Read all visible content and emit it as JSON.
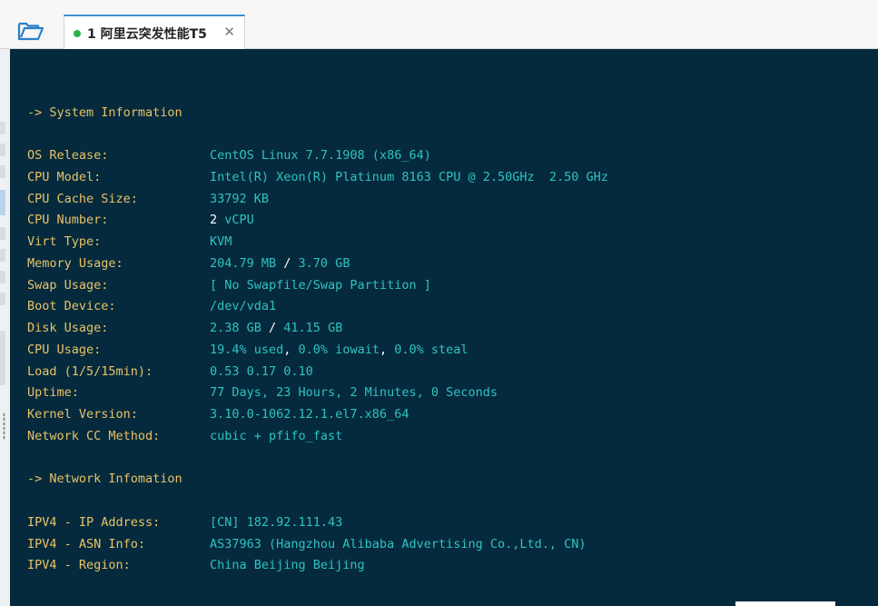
{
  "tab": {
    "label": "1 阿里云突发性能T5",
    "status_color": "#2bb24c",
    "close_icon": "close-icon"
  },
  "terminal": {
    "system_header": "-> System Information",
    "network_header": "-> Network Infomation",
    "system": {
      "os_release": {
        "key": "OS Release:",
        "value": "CentOS Linux 7.7.1908 (x86_64)"
      },
      "cpu_model": {
        "key": "CPU Model:",
        "value": "Intel(R) Xeon(R) Platinum 8163 CPU @ 2.50GHz  2.50 GHz"
      },
      "cpu_cache": {
        "key": "CPU Cache Size:",
        "value": "33792 KB"
      },
      "cpu_number": {
        "key": "CPU Number:",
        "value_num": "2",
        "value_unit": " vCPU"
      },
      "virt_type": {
        "key": "Virt Type:",
        "value": "KVM"
      },
      "memory": {
        "key": "Memory Usage:",
        "used": "204.79 MB",
        "sep": " / ",
        "total": "3.70 GB"
      },
      "swap": {
        "key": "Swap Usage:",
        "value": "[ No Swapfile/Swap Partition ]"
      },
      "boot": {
        "key": "Boot Device:",
        "value": "/dev/vda1"
      },
      "disk": {
        "key": "Disk Usage:",
        "used": "2.38 GB",
        "sep": " / ",
        "total": "41.15 GB"
      },
      "cpu_usage": {
        "key": "CPU Usage:",
        "used": "19.4% used",
        "sep1": ", ",
        "iowait": "0.0% iowait",
        "sep2": ", ",
        "steal": "0.0% steal"
      },
      "load": {
        "key": "Load (1/5/15min):",
        "value": "0.53 0.17 0.10"
      },
      "uptime": {
        "key": "Uptime:",
        "value": "77 Days, 23 Hours, 2 Minutes, 0 Seconds"
      },
      "kernel": {
        "key": "Kernel Version:",
        "value": "3.10.0-1062.12.1.el7.x86_64"
      },
      "cc": {
        "key": "Network CC Method:",
        "value": "cubic + pfifo_fast"
      }
    },
    "network": {
      "ip": {
        "key": "IPV4 - IP Address:",
        "value": "[CN] 182.92.111.43"
      },
      "asn": {
        "key": "IPV4 - ASN Info:",
        "value": "AS37963 (Hangzhou Alibaba Advertising Co.,Ltd., CN)"
      },
      "region": {
        "key": "IPV4 - Region:",
        "value": "China Beijing Beijing"
      }
    },
    "colors": {
      "background": "#052a3d",
      "key": "#e8c267",
      "value": "#2fc2c2",
      "highlight": "#ffffff"
    }
  }
}
